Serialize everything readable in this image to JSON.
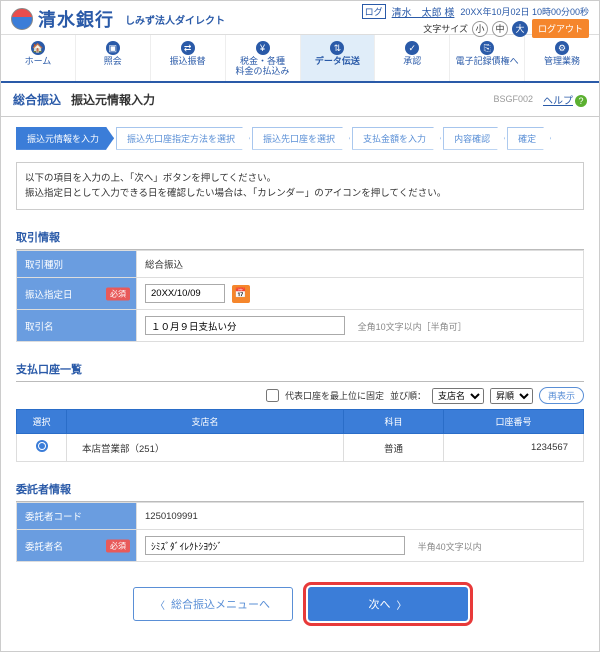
{
  "header": {
    "bank_name": "清水銀行",
    "service_name": "しみず法人ダイレクト",
    "user_badge": "ログ",
    "user_name": "清水　太郎 様",
    "datetime": "20XX年10月02日 10時00分00秒",
    "font_label": "文字サイズ",
    "font_small": "小",
    "font_med": "中",
    "font_large": "大",
    "logout": "ログアウト"
  },
  "nav": [
    {
      "icon": "🏠",
      "label": "ホーム"
    },
    {
      "icon": "▣",
      "label": "照会"
    },
    {
      "icon": "⇄",
      "label": "振込振替"
    },
    {
      "icon": "¥",
      "label": "税金・各種\n料金の払込み"
    },
    {
      "icon": "⇅",
      "label": "データ伝送"
    },
    {
      "icon": "✓",
      "label": "承認"
    },
    {
      "icon": "⎘",
      "label": "電子記録債権へ"
    },
    {
      "icon": "⚙",
      "label": "管理業務"
    }
  ],
  "titlebar": {
    "category": "総合振込",
    "title": "振込元情報入力",
    "code": "BSGF002",
    "help": "ヘルプ"
  },
  "steps": [
    "振込元情報を入力",
    "振込先口座指定方法を選択",
    "振込先口座を選択",
    "支払金額を入力",
    "内容確認",
    "確定"
  ],
  "intro": {
    "line1": "以下の項目を入力の上、「次へ」ボタンを押してください。",
    "line2": "振込指定日として入力できる日を確認したい場合は、「カレンダー」のアイコンを押してください。"
  },
  "section_transaction": {
    "title": "取引情報",
    "type_label": "取引種別",
    "type_value": "総合振込",
    "date_label": "振込指定日",
    "date_value": "20XX/10/09",
    "name_label": "取引名",
    "name_value": "１０月９日支払い分",
    "name_hint": "全角10文字以内［半角可］",
    "required": "必須"
  },
  "section_account": {
    "title": "支払口座一覧",
    "fix_label": "代表口座を最上位に固定",
    "sort_label": "並び順：",
    "sort_value": "支店名",
    "order_value": "昇順",
    "reload": "再表示",
    "cols": {
      "select": "選択",
      "branch": "支店名",
      "type": "科目",
      "number": "口座番号"
    },
    "rows": [
      {
        "branch": "本店営業部（251）",
        "type": "普通",
        "number": "1234567"
      }
    ]
  },
  "section_client": {
    "title": "委託者情報",
    "code_label": "委託者コード",
    "code_value": "1250109991",
    "name_label": "委託者名",
    "name_value": "ｼﾐｽﾞﾀﾞｲﾚｸﾄｼﾖｳｼﾞ",
    "name_hint": "半角40文字以内",
    "required": "必須"
  },
  "buttons": {
    "back": "総合振込メニューへ",
    "next": "次へ"
  }
}
